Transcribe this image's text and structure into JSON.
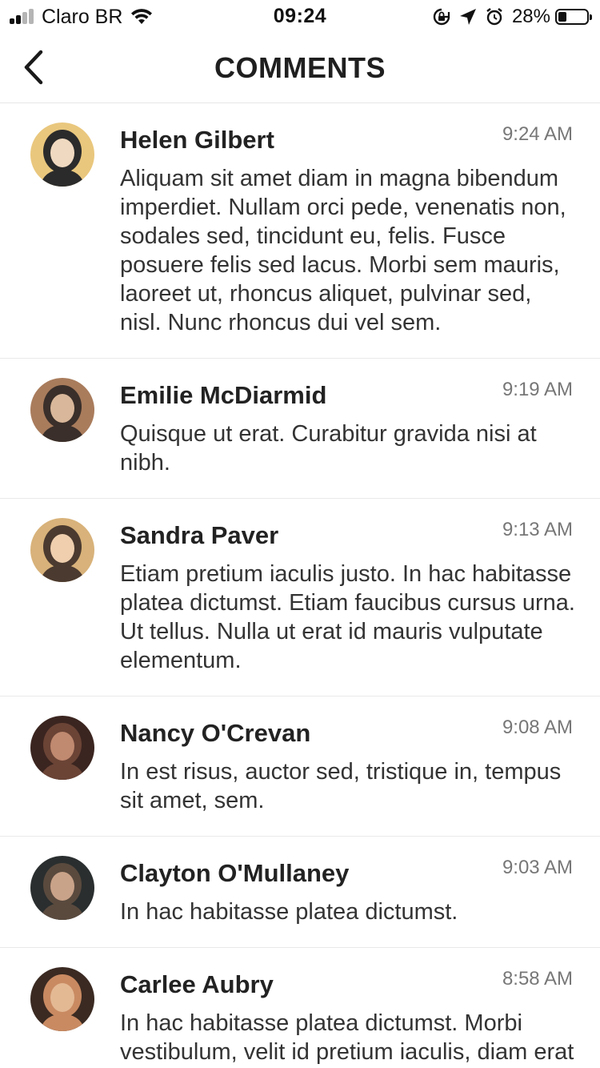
{
  "status_bar": {
    "carrier": "Claro BR",
    "time": "09:24",
    "battery_percent_text": "28%",
    "battery_level": 0.28
  },
  "nav": {
    "title": "COMMENTS",
    "back_icon": "chevron-left-icon"
  },
  "comments": [
    {
      "name": "Helen Gilbert",
      "time": "9:24 AM",
      "text": "Aliquam sit amet diam in magna bibendum imperdiet. Nullam orci pede, venenatis non, sodales sed, tincidunt eu, felis. Fusce posuere felis sed lacus. Morbi sem mauris, laoreet ut, rhoncus aliquet, pulvinar sed, nisl. Nunc rhoncus dui vel sem.",
      "avatar_colors": [
        "#e9c77d",
        "#efd9c0",
        "#2b2b2b"
      ]
    },
    {
      "name": "Emilie McDiarmid",
      "time": "9:19 AM",
      "text": "Quisque ut erat. Curabitur gravida nisi at nibh.",
      "avatar_colors": [
        "#a97c5c",
        "#d9b79a",
        "#3a2f2a"
      ]
    },
    {
      "name": "Sandra Paver",
      "time": "9:13 AM",
      "text": "Etiam pretium iaculis justo. In hac habitasse platea dictumst. Etiam faucibus cursus urna. Ut tellus. Nulla ut erat id mauris vulputate elementum.",
      "avatar_colors": [
        "#d8b27a",
        "#efcfae",
        "#4b3a2f"
      ]
    },
    {
      "name": "Nancy O'Crevan",
      "time": "9:08 AM",
      "text": "In est risus, auctor sed, tristique in, tempus sit amet, sem.",
      "avatar_colors": [
        "#3b2520",
        "#c08a70",
        "#6b4436"
      ]
    },
    {
      "name": "Clayton O'Mullaney",
      "time": "9:03 AM",
      "text": "In hac habitasse platea dictumst.",
      "avatar_colors": [
        "#2a2e2e",
        "#c9a389",
        "#5a4a3e"
      ]
    },
    {
      "name": "Carlee Aubry",
      "time": "8:58 AM",
      "text": "In hac habitasse platea dictumst. Morbi vestibulum, velit id pretium iaculis, diam erat fermentum justo.",
      "avatar_colors": [
        "#3a2a22",
        "#e3b994",
        "#c98a62"
      ]
    }
  ]
}
